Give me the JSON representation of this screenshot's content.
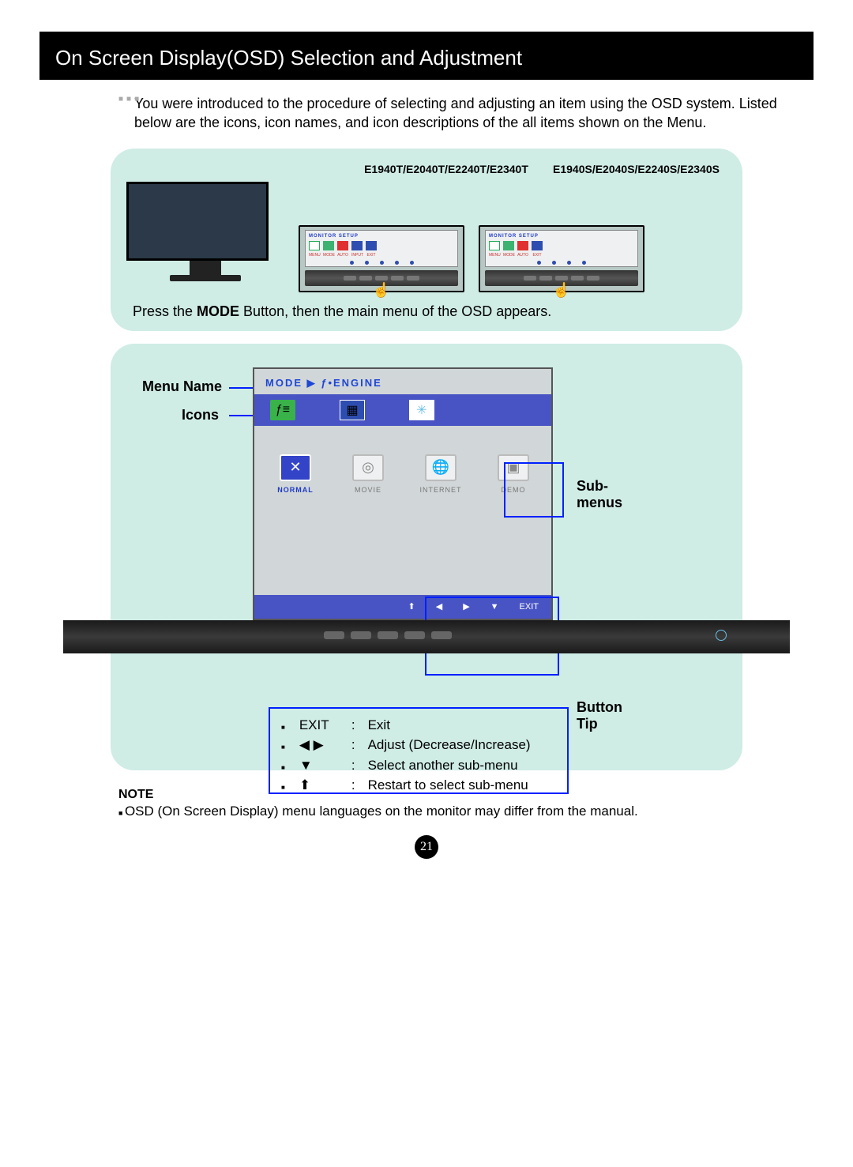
{
  "title": "On Screen Display(OSD) Selection and Adjustment",
  "intro": "You were introduced to the procedure of selecting and adjusting an item using the OSD system. Listed below are the icons, icon names, and icon descriptions of the all items shown on the Menu.",
  "models": {
    "t": "E1940T/E2040T/E2240T/E2340T",
    "s": "E1940S/E2040S/E2240S/E2340S"
  },
  "mini_osd_title": "MONITOR SETUP",
  "mini_labels": [
    "MENU",
    "MODE",
    "AUTO",
    "INPUT",
    "EXIT"
  ],
  "mini_labels_s": [
    "MENU",
    "MODE",
    "AUTO",
    "EXIT"
  ],
  "press_line_pre": "Press the ",
  "press_line_bold": "MODE",
  "press_line_post": " Button, then the main menu of the OSD appears.",
  "labels": {
    "menu_name": "Menu Name",
    "icons": "Icons",
    "sub": "Sub-\nmenus",
    "button_tip": "Button\nTip"
  },
  "osd": {
    "menu_title": "MODE ▶ ƒ•ENGINE",
    "top_icons": [
      "ƒ≡",
      "▦",
      "✳"
    ],
    "subs": [
      {
        "icon": "✕",
        "label": "NORMAL",
        "selected": true
      },
      {
        "icon": "◎",
        "label": "MOVIE",
        "selected": false
      },
      {
        "icon": "🌐",
        "label": "INTERNET",
        "selected": false
      },
      {
        "icon": "▣",
        "label": "DEMO",
        "selected": false
      }
    ],
    "nav": [
      "⬆",
      "◀",
      "▶",
      "▼",
      "EXIT"
    ]
  },
  "tips": [
    {
      "key": "EXIT",
      "desc": "Exit"
    },
    {
      "key": "◀ ▶",
      "desc": "Adjust (Decrease/Increase)"
    },
    {
      "key": "▼",
      "desc": "Select another sub-menu"
    },
    {
      "key": "⬆",
      "desc": "Restart to select sub-menu"
    }
  ],
  "note": {
    "title": "NOTE",
    "body": "OSD (On Screen Display) menu languages on the monitor may differ from the manual."
  },
  "page": "21"
}
